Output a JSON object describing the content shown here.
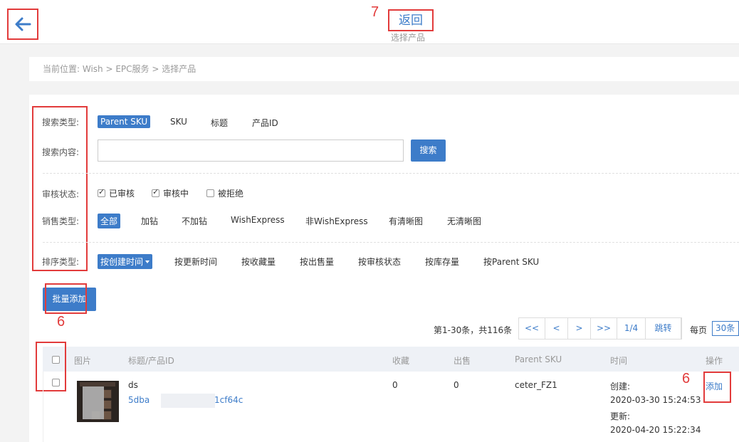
{
  "header": {
    "back_label": "返回",
    "subtitle": "选择产品"
  },
  "annotations": {
    "mark_7": "7",
    "mark_6a": "6",
    "mark_6b": "6"
  },
  "breadcrumb": "当前位置:  Wish > EPC服务 > 选择产品",
  "filters": {
    "search_type_label": "搜索类型:",
    "search_types": [
      "Parent SKU",
      "SKU",
      "标题",
      "产品ID"
    ],
    "search_content_label": "搜索内容:",
    "search_placeholder": "",
    "search_button": "搜索",
    "review_status_label": "审核状态:",
    "review_status": [
      {
        "label": "已审核",
        "checked": true
      },
      {
        "label": "审核中",
        "checked": true
      },
      {
        "label": "被拒绝",
        "checked": false
      }
    ],
    "sales_type_label": "销售类型:",
    "sales_types": [
      "全部",
      "加钻",
      "不加钻",
      "WishExpress",
      "非WishExpress",
      "有清晰图",
      "无清晰图"
    ],
    "sort_type_label": "排序类型:",
    "sort_types": [
      "按创建时间",
      "按更新时间",
      "按收藏量",
      "按出售量",
      "按审核状态",
      "按库存量",
      "按Parent SKU"
    ]
  },
  "batch_add_button": "批量添加",
  "pagination": {
    "info": "第1-30条，共116条",
    "first": "<<",
    "prev": "<",
    "next": ">",
    "last": ">>",
    "page": "1/4",
    "jump": "跳转",
    "per_page_label": "每页",
    "per_page_value": "30条"
  },
  "table": {
    "headers": {
      "image": "图片",
      "title": "标题/产品ID",
      "favorites": "收藏",
      "sales": "出售",
      "parent_sku": "Parent SKU",
      "time": "时间",
      "action": "操作"
    },
    "rows": [
      {
        "title": "ds",
        "id_prefix": "5dba",
        "id_suffix": "1cf64c",
        "favorites": "0",
        "sales": "0",
        "parent_sku": "ceter_FZ1",
        "created_label": "创建:",
        "created": "2020-03-30 15:24:53",
        "updated_label": "更新:",
        "updated": "2020-04-20 15:22:34",
        "action": "添加"
      }
    ]
  },
  "colors": {
    "accent": "#3d7cc9",
    "annotation": "#e23b3b"
  }
}
